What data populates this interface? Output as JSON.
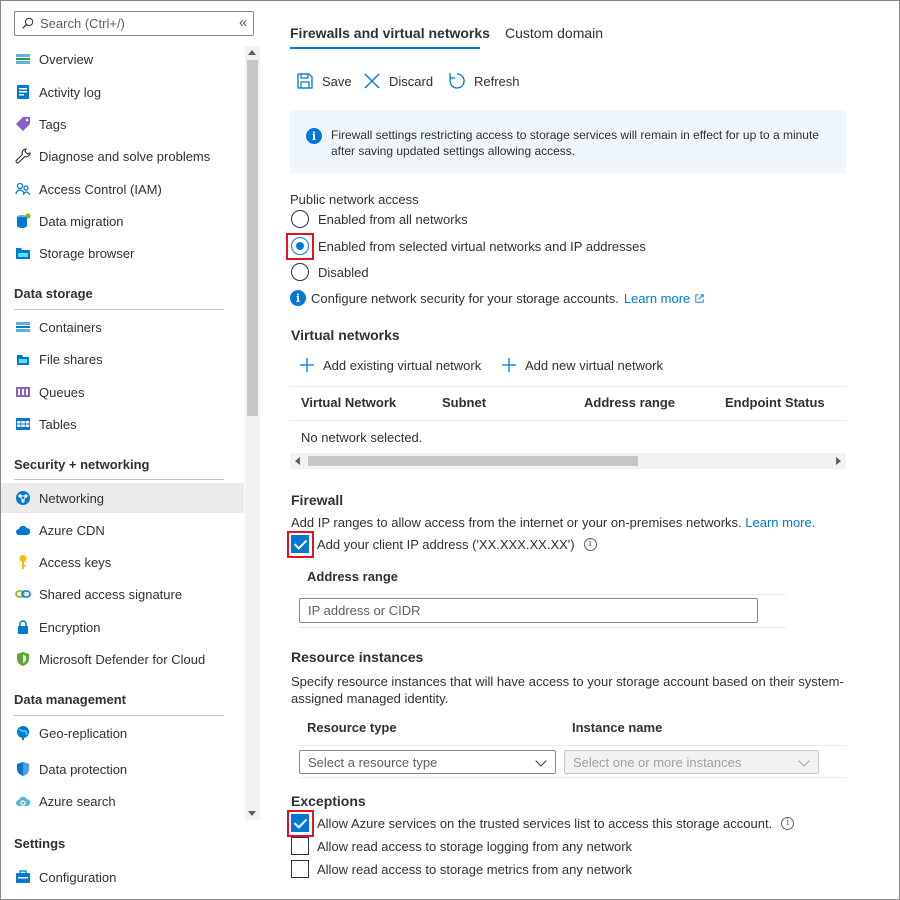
{
  "sidebar": {
    "search_placeholder": "Search (Ctrl+/)",
    "collapse_glyph": "«",
    "items": [
      {
        "label": "Overview",
        "icon": "overview-icon"
      },
      {
        "label": "Activity log",
        "icon": "activity-log-icon"
      },
      {
        "label": "Tags",
        "icon": "tag-icon"
      },
      {
        "label": "Diagnose and solve problems",
        "icon": "wrench-icon"
      },
      {
        "label": "Access Control (IAM)",
        "icon": "people-icon"
      },
      {
        "label": "Data migration",
        "icon": "data-migration-icon"
      },
      {
        "label": "Storage browser",
        "icon": "storage-browser-icon"
      }
    ],
    "sections": [
      {
        "title": "Data storage",
        "items": [
          {
            "label": "Containers",
            "icon": "containers-icon"
          },
          {
            "label": "File shares",
            "icon": "file-shares-icon"
          },
          {
            "label": "Queues",
            "icon": "queues-icon"
          },
          {
            "label": "Tables",
            "icon": "tables-icon"
          }
        ]
      },
      {
        "title": "Security + networking",
        "items": [
          {
            "label": "Networking",
            "icon": "networking-icon",
            "selected": true
          },
          {
            "label": "Azure CDN",
            "icon": "cloud-icon"
          },
          {
            "label": "Access keys",
            "icon": "key-icon"
          },
          {
            "label": "Shared access signature",
            "icon": "link-icon"
          },
          {
            "label": "Encryption",
            "icon": "lock-icon"
          },
          {
            "label": "Microsoft Defender for Cloud",
            "icon": "shield-icon"
          }
        ]
      },
      {
        "title": "Data management",
        "items": [
          {
            "label": "Geo-replication",
            "icon": "globe-icon"
          },
          {
            "label": "Data protection",
            "icon": "shield-blue-icon"
          },
          {
            "label": "Azure search",
            "icon": "cloud-search-icon"
          }
        ]
      },
      {
        "title": "Settings",
        "items": [
          {
            "label": "Configuration",
            "icon": "configuration-icon"
          }
        ]
      }
    ]
  },
  "tabs": [
    "Firewalls and virtual networks",
    "Custom domain"
  ],
  "toolbar": {
    "save": "Save",
    "discard": "Discard",
    "refresh": "Refresh"
  },
  "info_banner": "Firewall settings restricting access to storage services will remain in effect for up to a minute after saving updated settings allowing access.",
  "public_access": {
    "label": "Public network access",
    "options": [
      "Enabled from all networks",
      "Enabled from selected virtual networks and IP addresses",
      "Disabled"
    ],
    "selected_index": 1,
    "note": "Configure network security for your storage accounts.",
    "learn_more": "Learn more"
  },
  "virtual_networks": {
    "title": "Virtual networks",
    "add_existing": "Add existing virtual network",
    "add_new": "Add new virtual network",
    "columns": [
      "Virtual Network",
      "Subnet",
      "Address range",
      "Endpoint Status"
    ],
    "empty": "No network selected."
  },
  "firewall": {
    "title": "Firewall",
    "description": "Add IP ranges to allow access from the internet or your on-premises networks.",
    "learn_more": "Learn more.",
    "client_ip_label": "Add your client IP address ('XX.XXX.XX.XX')",
    "client_ip_checked": true,
    "address_range_header": "Address range",
    "address_placeholder": "IP address or CIDR"
  },
  "resource_instances": {
    "title": "Resource instances",
    "description": "Specify resource instances that will have access to your storage account based on their system-assigned managed identity.",
    "col_type": "Resource type",
    "col_instance": "Instance name",
    "type_placeholder": "Select a resource type",
    "instance_placeholder": "Select one or more instances"
  },
  "exceptions": {
    "title": "Exceptions",
    "items": [
      {
        "label": "Allow Azure services on the trusted services list to access this storage account.",
        "checked": true
      },
      {
        "label": "Allow read access to storage logging from any network",
        "checked": false
      },
      {
        "label": "Allow read access to storage metrics from any network",
        "checked": false
      }
    ]
  },
  "colors": {
    "accent": "#0078d4",
    "highlight": "#e81123"
  }
}
